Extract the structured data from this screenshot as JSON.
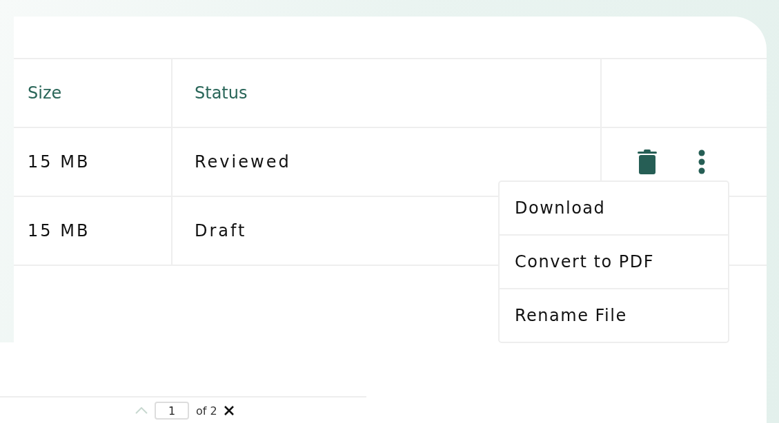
{
  "table": {
    "columns": [
      "Size",
      "Status"
    ],
    "rows": [
      {
        "size": "15 MB",
        "status": "Reviewed",
        "actions": [
          {
            "kind": "delete"
          },
          {
            "kind": "more"
          }
        ]
      },
      {
        "size": "15 MB",
        "status": "Draft"
      }
    ]
  },
  "menu": {
    "items": [
      "Download",
      "Convert to PDF",
      "Rename File"
    ]
  },
  "pagination": {
    "page": "1",
    "total": "of 2"
  }
}
